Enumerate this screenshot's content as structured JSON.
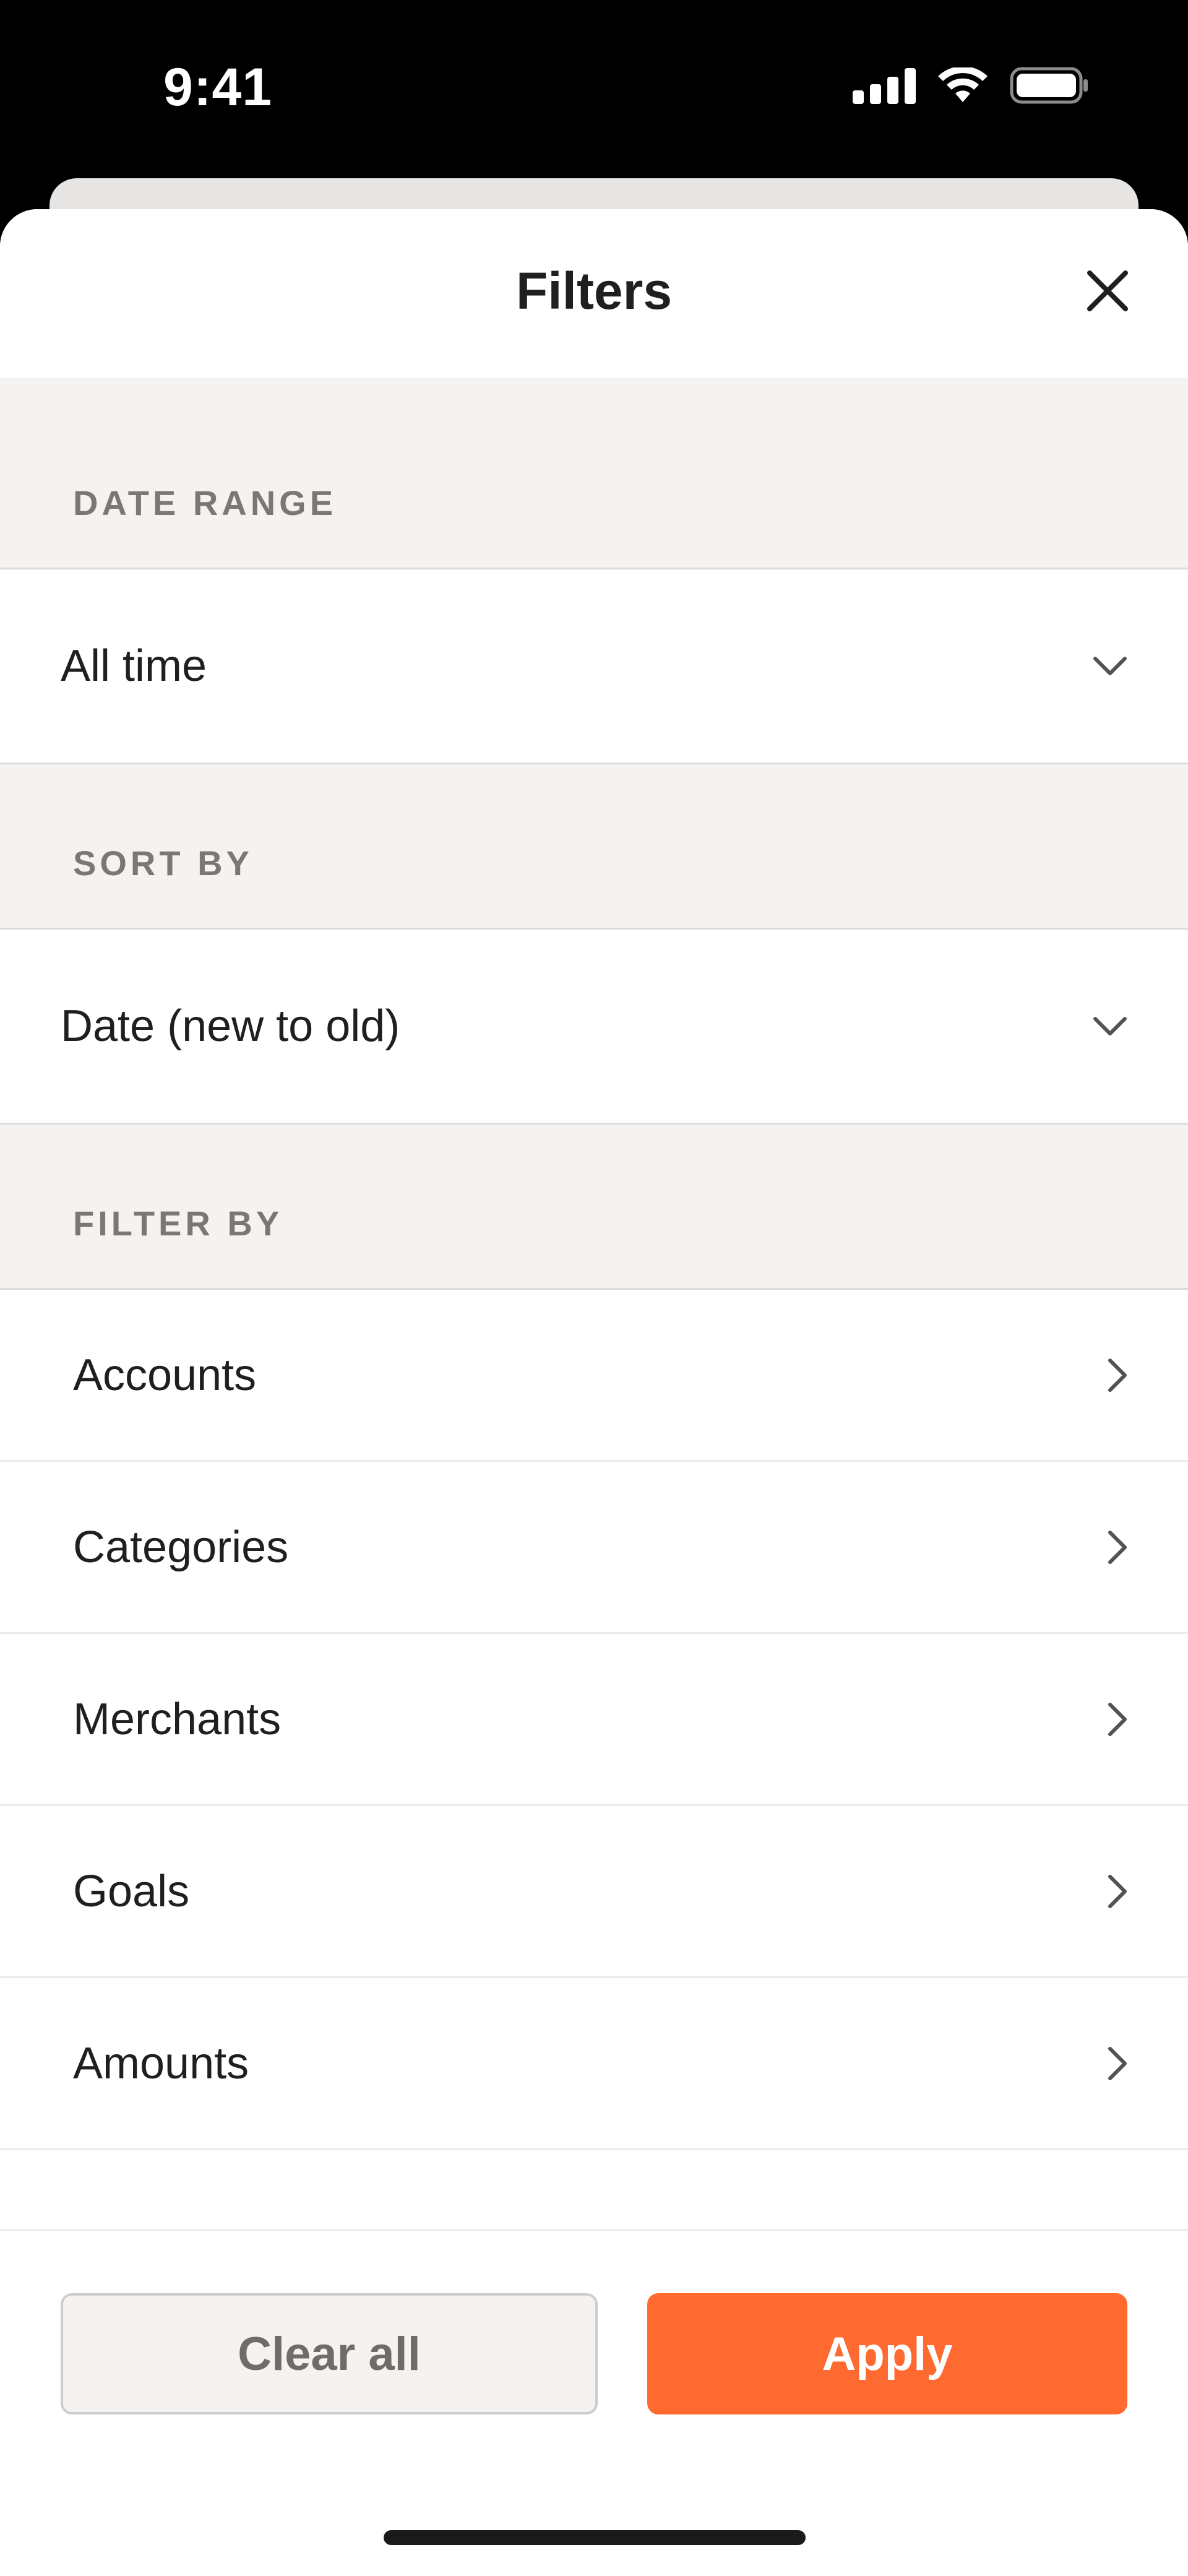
{
  "status_bar": {
    "time": "9:41",
    "icons": [
      "signal-icon",
      "wifi-icon",
      "battery-icon"
    ]
  },
  "sheet": {
    "title": "Filters",
    "close_icon": "close-icon"
  },
  "sections": {
    "date_range": {
      "label": "DATE RANGE",
      "value": "All time",
      "icon": "chevron-down-icon"
    },
    "sort_by": {
      "label": "SORT BY",
      "value": "Date (new to old)",
      "icon": "chevron-down-icon"
    },
    "filter_by": {
      "label": "FILTER BY",
      "items": [
        {
          "label": "Accounts"
        },
        {
          "label": "Categories"
        },
        {
          "label": "Merchants"
        },
        {
          "label": "Goals"
        },
        {
          "label": "Amounts"
        }
      ],
      "item_icon": "chevron-right-icon"
    }
  },
  "footer": {
    "clear_label": "Clear all",
    "apply_label": "Apply"
  },
  "colors": {
    "accent": "#ff6a30",
    "section_bg": "#f4f3f2",
    "text_primary": "#1f1f1f",
    "text_muted": "#7a7775"
  }
}
